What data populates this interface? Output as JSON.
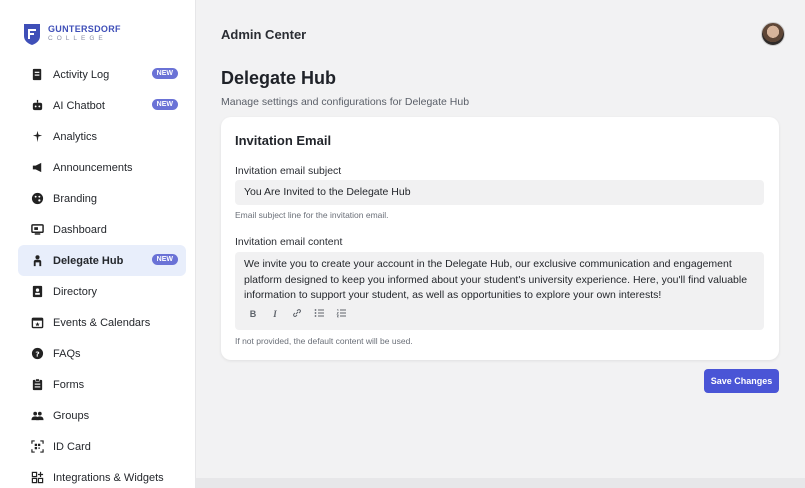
{
  "brand": {
    "name": "GUNTERSDORF",
    "sub": "COLLEGE",
    "colors": {
      "primary": "#3f4fb8",
      "accent": "#4a55d6",
      "badge": "#6a72d6",
      "active_bg": "#e8eefb"
    }
  },
  "header": {
    "title": "Admin Center"
  },
  "sidebar": {
    "items": [
      {
        "label": "Activity Log",
        "icon": "activity-log-icon",
        "badge": "NEW",
        "active": false
      },
      {
        "label": "AI Chatbot",
        "icon": "chatbot-icon",
        "badge": "NEW",
        "active": false
      },
      {
        "label": "Analytics",
        "icon": "analytics-icon",
        "badge": "",
        "active": false
      },
      {
        "label": "Announcements",
        "icon": "megaphone-icon",
        "badge": "",
        "active": false
      },
      {
        "label": "Branding",
        "icon": "palette-icon",
        "badge": "",
        "active": false
      },
      {
        "label": "Dashboard",
        "icon": "dashboard-icon",
        "badge": "",
        "active": false
      },
      {
        "label": "Delegate Hub",
        "icon": "delegate-icon",
        "badge": "NEW",
        "active": true
      },
      {
        "label": "Directory",
        "icon": "directory-icon",
        "badge": "",
        "active": false
      },
      {
        "label": "Events & Calendars",
        "icon": "calendar-icon",
        "badge": "",
        "active": false
      },
      {
        "label": "FAQs",
        "icon": "help-icon",
        "badge": "",
        "active": false
      },
      {
        "label": "Forms",
        "icon": "forms-icon",
        "badge": "",
        "active": false
      },
      {
        "label": "Groups",
        "icon": "groups-icon",
        "badge": "",
        "active": false
      },
      {
        "label": "ID Card",
        "icon": "qr-icon",
        "badge": "",
        "active": false
      },
      {
        "label": "Integrations & Widgets",
        "icon": "widgets-icon",
        "badge": "",
        "active": false
      }
    ]
  },
  "main": {
    "title": "Delegate Hub",
    "subtitle": "Manage settings and configurations for Delegate Hub",
    "card": {
      "title": "Invitation Email",
      "subject": {
        "label": "Invitation email subject",
        "value": "You Are Invited to the Delegate Hub",
        "helper": "Email subject line for the invitation email."
      },
      "content": {
        "label": "Invitation email content",
        "value": "We invite you to create your account in the Delegate Hub, our exclusive communication and engagement platform designed to keep you informed about your student's university experience. Here, you'll find valuable information to support your student, as well as opportunities to explore your own interests!",
        "helper": "If not provided, the default content will be used.",
        "toolbar": [
          "B",
          "I",
          "link",
          "bullet-list",
          "numbered-list"
        ]
      }
    },
    "save_label": "Save Changes"
  }
}
